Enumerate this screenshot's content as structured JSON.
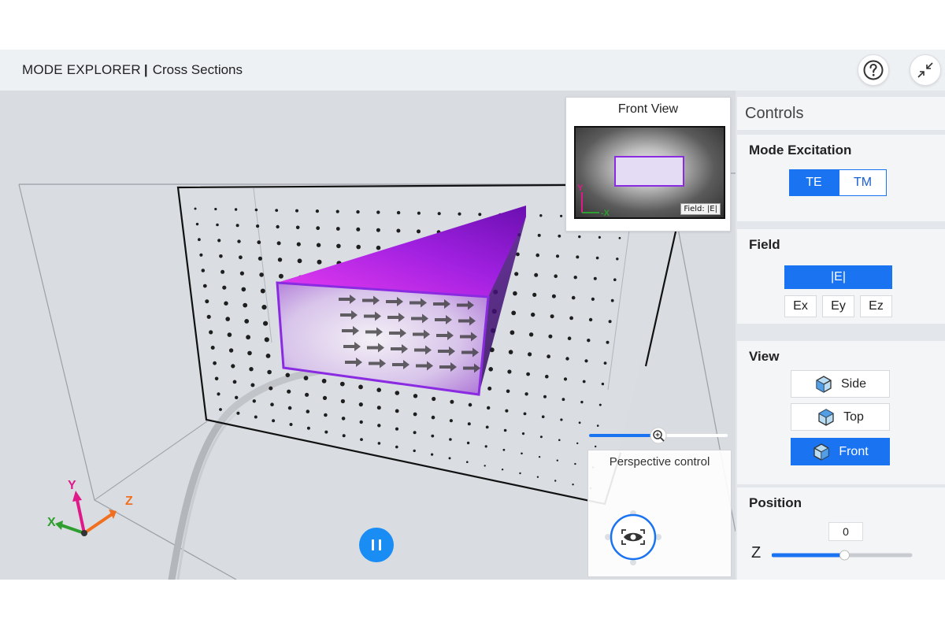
{
  "header": {
    "app_name": "MODE EXPLORER",
    "separator": "|",
    "subtitle": "Cross Sections",
    "help_icon": "question-circle-icon",
    "minimize_icon": "collapse-arrows-icon"
  },
  "front_view": {
    "title": "Front View",
    "field_label": "Field: |E|",
    "axis_y": "Y",
    "axis_x": "-X"
  },
  "axes": {
    "x": "X",
    "y": "Y",
    "z": "Z"
  },
  "perspective": {
    "title": "Perspective control",
    "icon": "eye-icon"
  },
  "zoom": {
    "level": 0.5,
    "icon": "zoom-in-icon"
  },
  "playback": {
    "state": "playing",
    "icon": "pause-icon"
  },
  "controls": {
    "title": "Controls",
    "mode_excitation": {
      "title": "Mode Excitation",
      "options": [
        "TE",
        "TM"
      ],
      "selected": "TE"
    },
    "field": {
      "title": "Field",
      "magnitude": "|E|",
      "components": [
        "Ex",
        "Ey",
        "Ez"
      ],
      "selected": "|E|"
    },
    "view": {
      "title": "View",
      "options": [
        "Side",
        "Top",
        "Front"
      ],
      "selected": "Front",
      "icon": "cube-icon"
    },
    "position": {
      "title": "Position",
      "axis": "Z",
      "value": "0",
      "fraction": 0.52
    }
  },
  "colors": {
    "accent": "#1a73f0",
    "pause_button": "#1a8df5",
    "waveguide": "#a020f0",
    "axis_x": "#2e9e2e",
    "axis_y": "#e0198a",
    "axis_z": "#f07020"
  }
}
